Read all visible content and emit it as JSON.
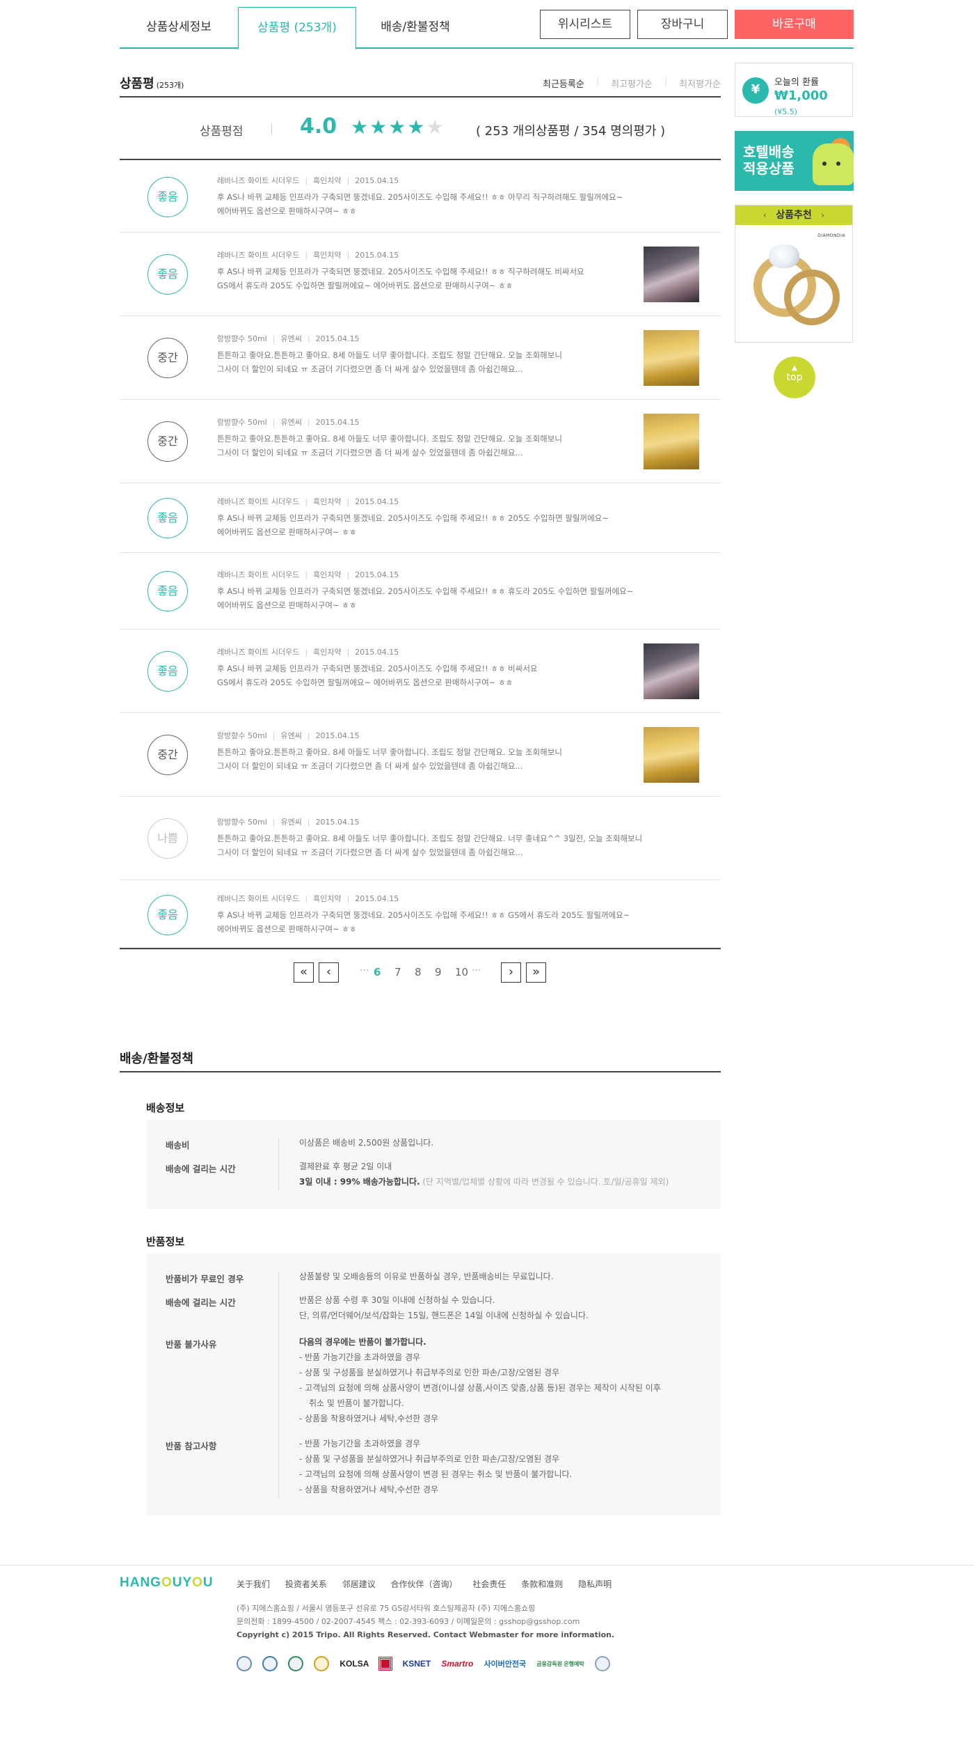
{
  "tabs": [
    {
      "label": "상품상세정보"
    },
    {
      "label": "상품평 (253개)"
    },
    {
      "label": "배송/환불정책"
    }
  ],
  "actions": {
    "wishlist": "위시리스트",
    "cart": "장바구니",
    "buy": "바로구매"
  },
  "reviews_section": {
    "title": "상품평",
    "count": "(253개)",
    "sorts": [
      "최근등록순",
      "최고평가순",
      "최저평가순"
    ],
    "score_label": "상품평점",
    "score": "4.0",
    "stars": 4,
    "summary": "( 253 개의상품평 / 354 명의평가 )"
  },
  "reviews": [
    {
      "rating": "좋음",
      "product": "레바니즈 화이트 시더우드",
      "user": "흑인치약",
      "date": "2015.04.15",
      "text": "후 AS나 바뀌 교체등 인프라가 구축되면 뚱겠네요. 205사이즈도 수입해 주세요!! ㅎㅎ 아무리 직구하려해도 팔릴꺼에요~\n에어바뀌도 옵션으로 판매하시구여~ ㅎㅎ",
      "thumb": ""
    },
    {
      "rating": "좋음",
      "product": "레바니즈 화이트 시더우드",
      "user": "흑인치약",
      "date": "2015.04.15",
      "text": "후 AS나 바뀌 교체등 인프라가 구축되면 뚱겠네요. 205사이즈도 수입해 주세요!! ㅎㅎ 직구하려해도 비싸서요\nGS에서 휴도라 205도 수입하면 팔릴꺼에요~ 에어바뀌도 옵션으로 판매하시구여~ ㅎㅎ",
      "thumb": "perf1"
    },
    {
      "rating": "중간",
      "product": "랑방향수 50ml",
      "user": "유엔씨",
      "date": "2015.04.15",
      "text": "튼튼하고 좋아요.튼튼하고 좋아요. 8세 아들도 너무 좋아합니다. 조립도 정말 간단해요. 오늘 조회해보니\n그사이 더 할인이 되네요 ㅠ 조금더 기다렸으면 좀 더 싸게 살수 있었을텐데 좀 아쉽긴해요...",
      "thumb": "perf2"
    },
    {
      "rating": "중간",
      "product": "랑방향수 50ml",
      "user": "유엔씨",
      "date": "2015.04.15",
      "text": "튼튼하고 좋아요.튼튼하고 좋아요. 8세 아들도 너무 좋아합니다. 조립도 정말 간단해요. 오늘 조회해보니\n그사이 더 할인이 되네요 ㅠ 조금더 기다렸으면 좀 더 싸게 살수 있었을텐데 좀 아쉽긴해요...",
      "thumb": "perf2"
    },
    {
      "rating": "좋음",
      "product": "레바니즈 화이트 시더우드",
      "user": "흑인치약",
      "date": "2015.04.15",
      "text": "후 AS나 바뀌 교체등 인프라가 구축되면 뚱겠네요. 205사이즈도 수입해 주세요!! ㅎㅎ 205도 수입하면 팔릴꺼에요~\n에어바뀌도 옵션으로 판매하시구여~ ㅎㅎ",
      "thumb": ""
    },
    {
      "rating": "좋음",
      "product": "레바니즈 화이트 시더우드",
      "user": "흑인치약",
      "date": "2015.04.15",
      "text": "후 AS나 바뀌 교체등 인프라가 구축되면 뚱겠네요. 205사이즈도 수입해 주세요!! ㅎㅎ 휴도라 205도 수입하면 팔릴꺼에요~\n에어바뀌도 옵션으로 판매하시구여~ ㅎㅎ",
      "thumb": ""
    },
    {
      "rating": "좋음",
      "product": "레바니즈 화이트 시더우드",
      "user": "흑인치약",
      "date": "2015.04.15",
      "text": "후 AS나 바뀌 교체등 인프라가 구축되면 뚱겠네요. 205사이즈도 수입해 주세요!! ㅎㅎ 비싸서요\nGS에서 휴도라 205도 수입하면 팔릴꺼에요~ 에어바뀌도 옵션으로 판매하시구여~ ㅎㅎ",
      "thumb": "perf1"
    },
    {
      "rating": "중간",
      "product": "랑방향수 50ml",
      "user": "유엔씨",
      "date": "2015.04.15",
      "text": "튼튼하고 좋아요.튼튼하고 좋아요. 8세 아들도 너무 좋아합니다. 조립도 정말 간단해요. 오늘 조회해보니\n그사이 더 할인이 되네요 ㅠ 조금더 기다렸으면 좀 더 싸게 살수 있었을텐데 좀 아쉽긴해요...",
      "thumb": "perf2"
    },
    {
      "rating": "나쁨",
      "product": "랑방향수 50ml",
      "user": "유엔씨",
      "date": "2015.04.15",
      "text": "튼튼하고 좋아요.튼튼하고 좋아요. 8세 아들도 너무 좋아합니다. 조립도 정말 간단해요. 너무 좋네요^^ 3일전, 오늘 조회해보니\n그사이 더 할인이 되네요 ㅠ 조금더 기다렸으면 좀 더 싸게 살수 있었을텐데 좀 아쉽긴해요...",
      "thumb": ""
    },
    {
      "rating": "좋음",
      "product": "레바니즈 화이트 시더우드",
      "user": "흑인치약",
      "date": "2015.04.15",
      "text": "후 AS나 바뀌 교체등 인프라가 구축되면 뚱겠네요. 205사이즈도 수입해 주세요!! ㅎㅎ GS에서 휴도라 205도 팔릴꺼에요~\n에어바뀌도 옵션으로 판매하시구여~ ㅎㅎ",
      "thumb": ""
    }
  ],
  "pagination": {
    "first": "«",
    "prev": "‹",
    "dots_before": "···",
    "pages": [
      "6",
      "7",
      "8",
      "9",
      "10"
    ],
    "current": "6",
    "dots_after": "···",
    "next": "›",
    "last": "»"
  },
  "policy": {
    "title": "배송/환불정책",
    "shipping": {
      "title": "배송정보",
      "rows": [
        {
          "label": "배송비",
          "lines": [
            "이상품은 배송비 2,500원 상품입니다."
          ]
        },
        {
          "label": "배송에 걸리는 시간",
          "lines": [
            "결제완료 후 평균 2일 이내"
          ],
          "strong": "3일 이내 : 99% 배송가능합니다.",
          "note": " (단 지역별/업체별 상황에 따라 변경될 수 있습니다. 토/일/공휴일 제외)"
        }
      ]
    },
    "refund": {
      "title": "반품정보",
      "rows": [
        {
          "label": "반품비가 무료인 경우",
          "lines": [
            "상품불량 및 오배송등의 이유로 반품하실 경우, 반품배송비는 무료입니다."
          ]
        },
        {
          "label": "배송에 걸리는 시간",
          "lines": [
            "반품은 상품 수령 후 30일 이내에 신청하실 수 있습니다.",
            "단, 의류/언더웨어/보석/잡화는 15일, 핸드폰은 14일 이내에 신청하실 수 있습니다."
          ]
        },
        {
          "label": "반품 불가사유",
          "head": "다음의 경우에는 반품이 불가합니다.",
          "lines": [
            "- 반품 가능기간을 초과하였을 경우",
            "- 상품 및 구성품을 분실하였거나 취급부주의로 인한 파손/고장/오염된 경우",
            "- 고객님의 요청에 의해 상품사양이 변경(이니셜 상품,사이즈 맞춤,상품 등)된 경우는 제작이 시작된 이후",
            "   취소 및 반품이 불가합니다.",
            "- 상품을 착용하였거나 세탁,수선한 경우"
          ]
        },
        {
          "label": "반품 참고사항",
          "lines": [
            "- 반품 가능기간을 초과하였을 경우",
            "- 상품 및 구성품을 분실하였거나 취급부주의로 인한 파손/고장/오염된 경우",
            "- 고객님의 요청에 의해 상품사양이 변경 된 경우는 취소 및 반품이 불가합니다.",
            "- 상품을 착용하였거나 세탁,수선한 경우"
          ]
        }
      ]
    }
  },
  "sidebar": {
    "rate_label": "오늘의 환률",
    "rate_value": "₩1,000",
    "rate_sub": "(¥5.5)",
    "rate_icon": "¥",
    "hotel_line1": "호텔배송",
    "hotel_line2": "적용상품",
    "rec_title": "상품추천",
    "rec_logo": "DIAMONDIA",
    "top_label": "top"
  },
  "footer": {
    "logo_a": "HANG",
    "logo_o": "O",
    "logo_b": "UY",
    "logo_o2": "O",
    "logo_c": "U",
    "links": [
      "关于我们",
      "投资者关系",
      "邻居建议",
      "合作伙伴（咨询）",
      "社会责任",
      "条款和准则",
      "隐私声明"
    ],
    "info1": "(주) 지에스홈쇼핑 / 서울시 영등포구 선유로 75 GS강서타워 호스팅제공자 (주) 지에스홈쇼핑",
    "info2": "문의전화 : 1899-4500 / 02-2007-4545 팩스 : 02-393-6093 / 이메일문의 : gsshop@gsshop.com",
    "copyright": "Copyright c) 2015 Tripo. All Rights Reserved. Contact Webmaster for more information.",
    "certs": {
      "ccm": "",
      "kolsa": "KOLSA",
      "ksnet": "KSNET",
      "smartro": "Smartro",
      "cyber": "사이버안전국",
      "bank": "금융감독원\n은행예탁"
    }
  }
}
